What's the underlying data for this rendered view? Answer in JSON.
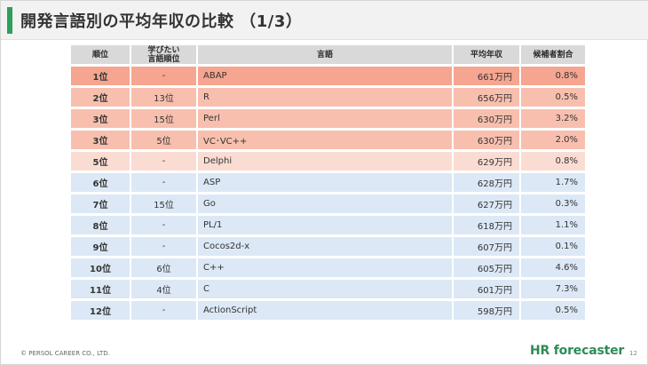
{
  "title": "開発言語別の平均年収の比較 （1/3）",
  "table": {
    "headers": [
      "順位",
      "学びたい\n言語順位",
      "言語",
      "平均年収",
      "候補者割合"
    ],
    "rows": [
      {
        "rank": "1位",
        "learn_rank": "-",
        "language": "ABAP",
        "salary": "661万円",
        "ratio": "0.8%",
        "bg": "#f5a590"
      },
      {
        "rank": "2位",
        "learn_rank": "13位",
        "language": "R",
        "salary": "656万円",
        "ratio": "0.5%",
        "bg": "#f8bfae"
      },
      {
        "rank": "3位",
        "learn_rank": "15位",
        "language": "Perl",
        "salary": "630万円",
        "ratio": "3.2%",
        "bg": "#f8bfae"
      },
      {
        "rank": "3位",
        "learn_rank": "5位",
        "language": "VC･VC++",
        "salary": "630万円",
        "ratio": "2.0%",
        "bg": "#f8bfae"
      },
      {
        "rank": "5位",
        "learn_rank": "-",
        "language": "Delphi",
        "salary": "629万円",
        "ratio": "0.8%",
        "bg": "#fbdcd3"
      },
      {
        "rank": "6位",
        "learn_rank": "-",
        "language": "ASP",
        "salary": "628万円",
        "ratio": "1.7%",
        "bg": "#dce8f5"
      },
      {
        "rank": "7位",
        "learn_rank": "15位",
        "language": "Go",
        "salary": "627万円",
        "ratio": "0.3%",
        "bg": "#dce8f5"
      },
      {
        "rank": "8位",
        "learn_rank": "-",
        "language": "PL/1",
        "salary": "618万円",
        "ratio": "1.1%",
        "bg": "#dce8f5"
      },
      {
        "rank": "9位",
        "learn_rank": "-",
        "language": "Cocos2d-x",
        "salary": "607万円",
        "ratio": "0.1%",
        "bg": "#dce8f5"
      },
      {
        "rank": "10位",
        "learn_rank": "6位",
        "language": "C++",
        "salary": "605万円",
        "ratio": "4.6%",
        "bg": "#dce8f5"
      },
      {
        "rank": "11位",
        "learn_rank": "4位",
        "language": "C",
        "salary": "601万円",
        "ratio": "7.3%",
        "bg": "#dce8f5"
      },
      {
        "rank": "12位",
        "learn_rank": "-",
        "language": "ActionScript",
        "salary": "598万円",
        "ratio": "0.5%",
        "bg": "#dce8f5"
      }
    ]
  },
  "footer": {
    "copyright": "© PERSOL CAREER CO., LTD.",
    "logo_hr": "HR",
    "logo_rest": " forecaster",
    "page": "12"
  }
}
